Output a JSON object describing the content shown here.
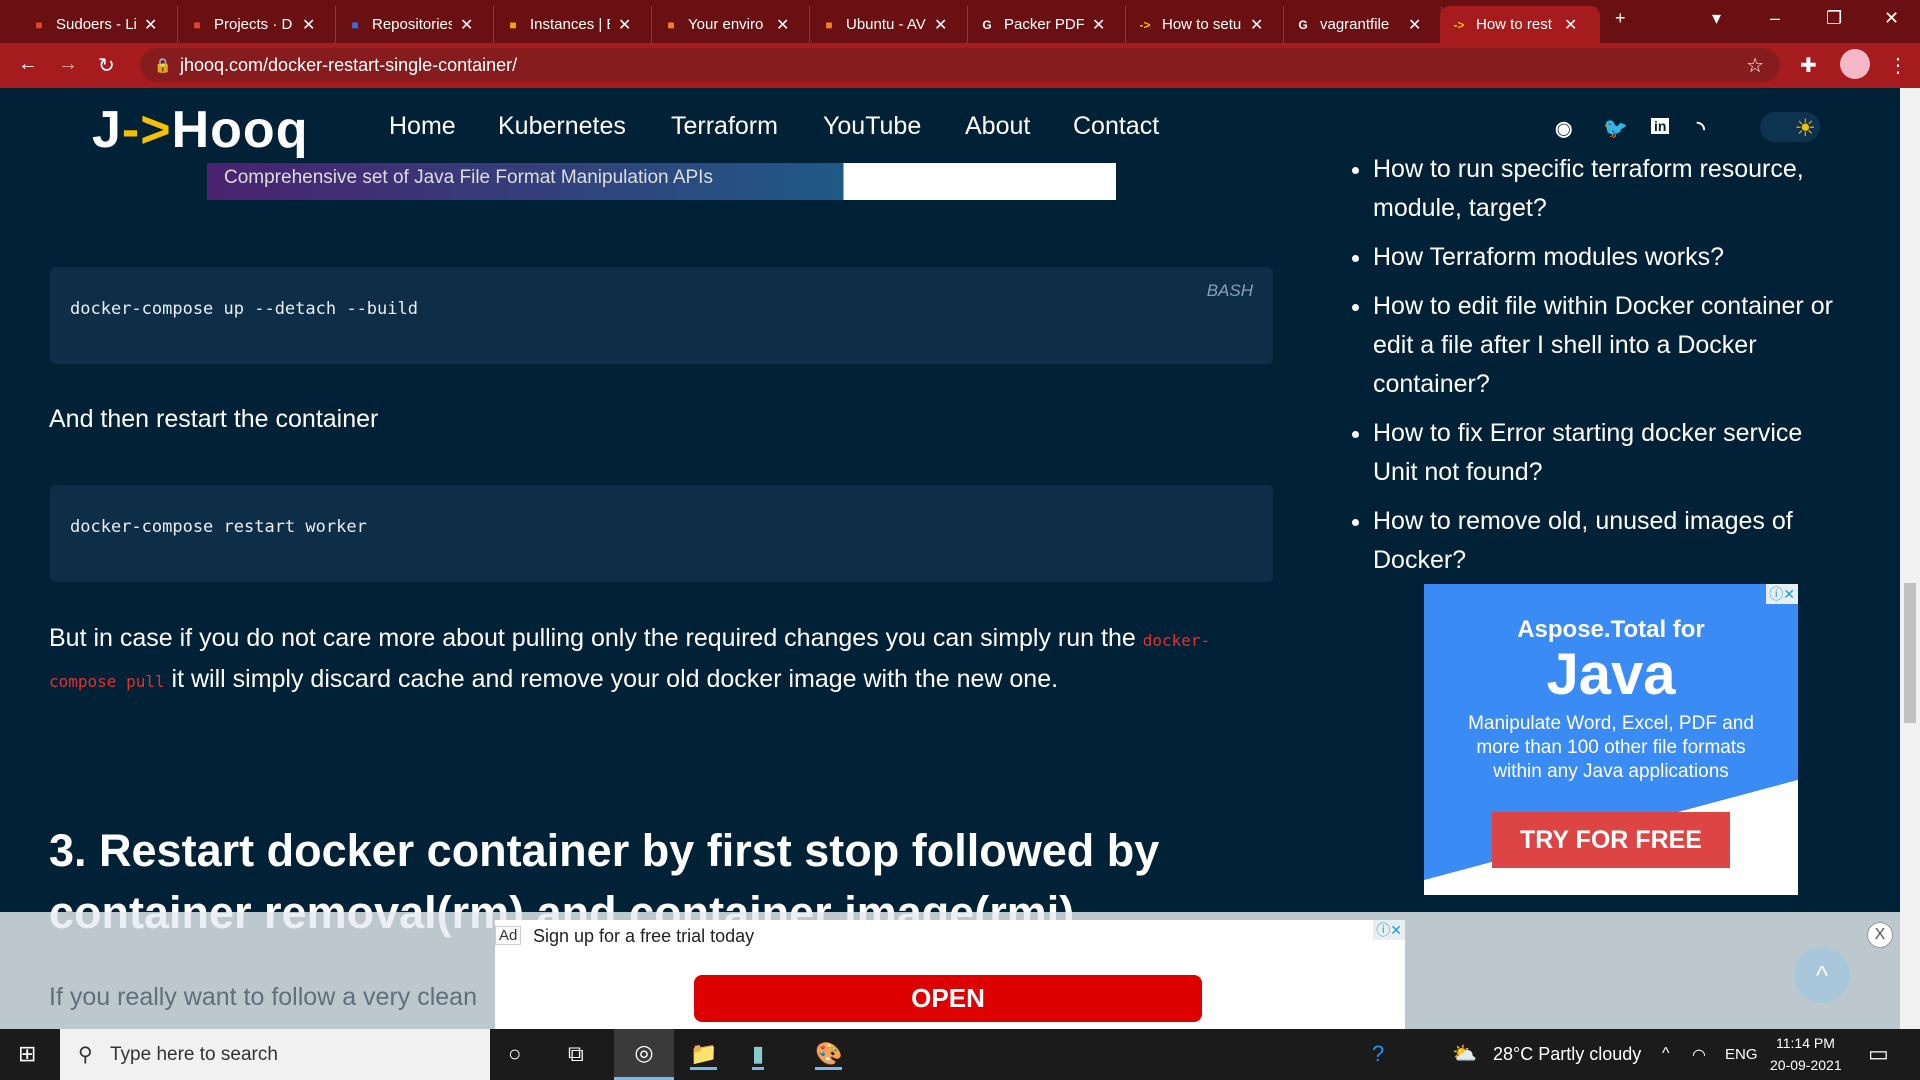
{
  "browser": {
    "tabs": [
      {
        "label": "Sudoers - Li",
        "icon": "gitlab-icon",
        "color": "#e24329"
      },
      {
        "label": "Projects · D",
        "icon": "gitlab-icon",
        "color": "#e24329"
      },
      {
        "label": "Repositories",
        "icon": "shield-icon",
        "color": "#2f6fe0"
      },
      {
        "label": "Instances | E",
        "icon": "box-icon",
        "color": "#f0a500"
      },
      {
        "label": "Your enviro",
        "icon": "cube-icon",
        "color": "#f08020"
      },
      {
        "label": "Ubuntu - AV",
        "icon": "cube-icon",
        "color": "#f08020"
      },
      {
        "label": "Packer PDF",
        "icon": "google-icon",
        "color": "#ffffff"
      },
      {
        "label": "How to setu",
        "icon": "jhooq-icon",
        "color": "#f6c000"
      },
      {
        "label": "vagrantfile",
        "icon": "google-icon",
        "color": "#ffffff"
      },
      {
        "label": "How to rest",
        "icon": "jhooq-icon",
        "color": "#f6c000"
      }
    ],
    "url": "jhooq.com/docker-restart-single-container/"
  },
  "site": {
    "logo_j": "J",
    "logo_arrow": "->",
    "logo_rest": "Hooq",
    "menu": [
      "Home",
      "Kubernetes",
      "Terraform",
      "YouTube",
      "About",
      "Contact"
    ],
    "top_ad": "Comprehensive set of Java File Format Manipulation APIs"
  },
  "article": {
    "code1": "docker-compose up --detach --build",
    "code1_lang": "BASH",
    "p1": "And then restart the container",
    "code2": "docker-compose restart worker",
    "p2_a": "But in case if you do not care more about pulling only the required changes you can simply run the ",
    "p2_code": "docker-compose pull",
    "p2_b": " it will simply discard cache and remove your old docker image with the new one.",
    "h3": "3. Restart docker container by first stop followed by container removal(rm) and container image(rmi)",
    "p3": "If you really want to follow a very clean"
  },
  "sidebar": {
    "items": [
      "How to run specific terraform resource, module, target?",
      "How Terraform modules works?",
      "How to edit file within Docker container or edit a file after I shell into a Docker container?",
      "How to fix Error starting docker service Unit not found?",
      "How to remove old, unused images of Docker?"
    ]
  },
  "side_ad": {
    "line1": "Aspose.Total for",
    "line2": "Java",
    "body": "Manipulate Word, Excel, PDF and more than 100 other file formats within any Java applications",
    "cta": "TRY FOR FREE"
  },
  "bottom_ad": {
    "tag": "Ad",
    "message": "Sign up for a free trial today",
    "button": "OPEN",
    "close": "X"
  },
  "taskbar": {
    "search_placeholder": "Type here to search",
    "weather": "28°C  Partly cloudy",
    "lang": "ENG",
    "time": "11:14 PM",
    "date": "20-09-2021"
  }
}
